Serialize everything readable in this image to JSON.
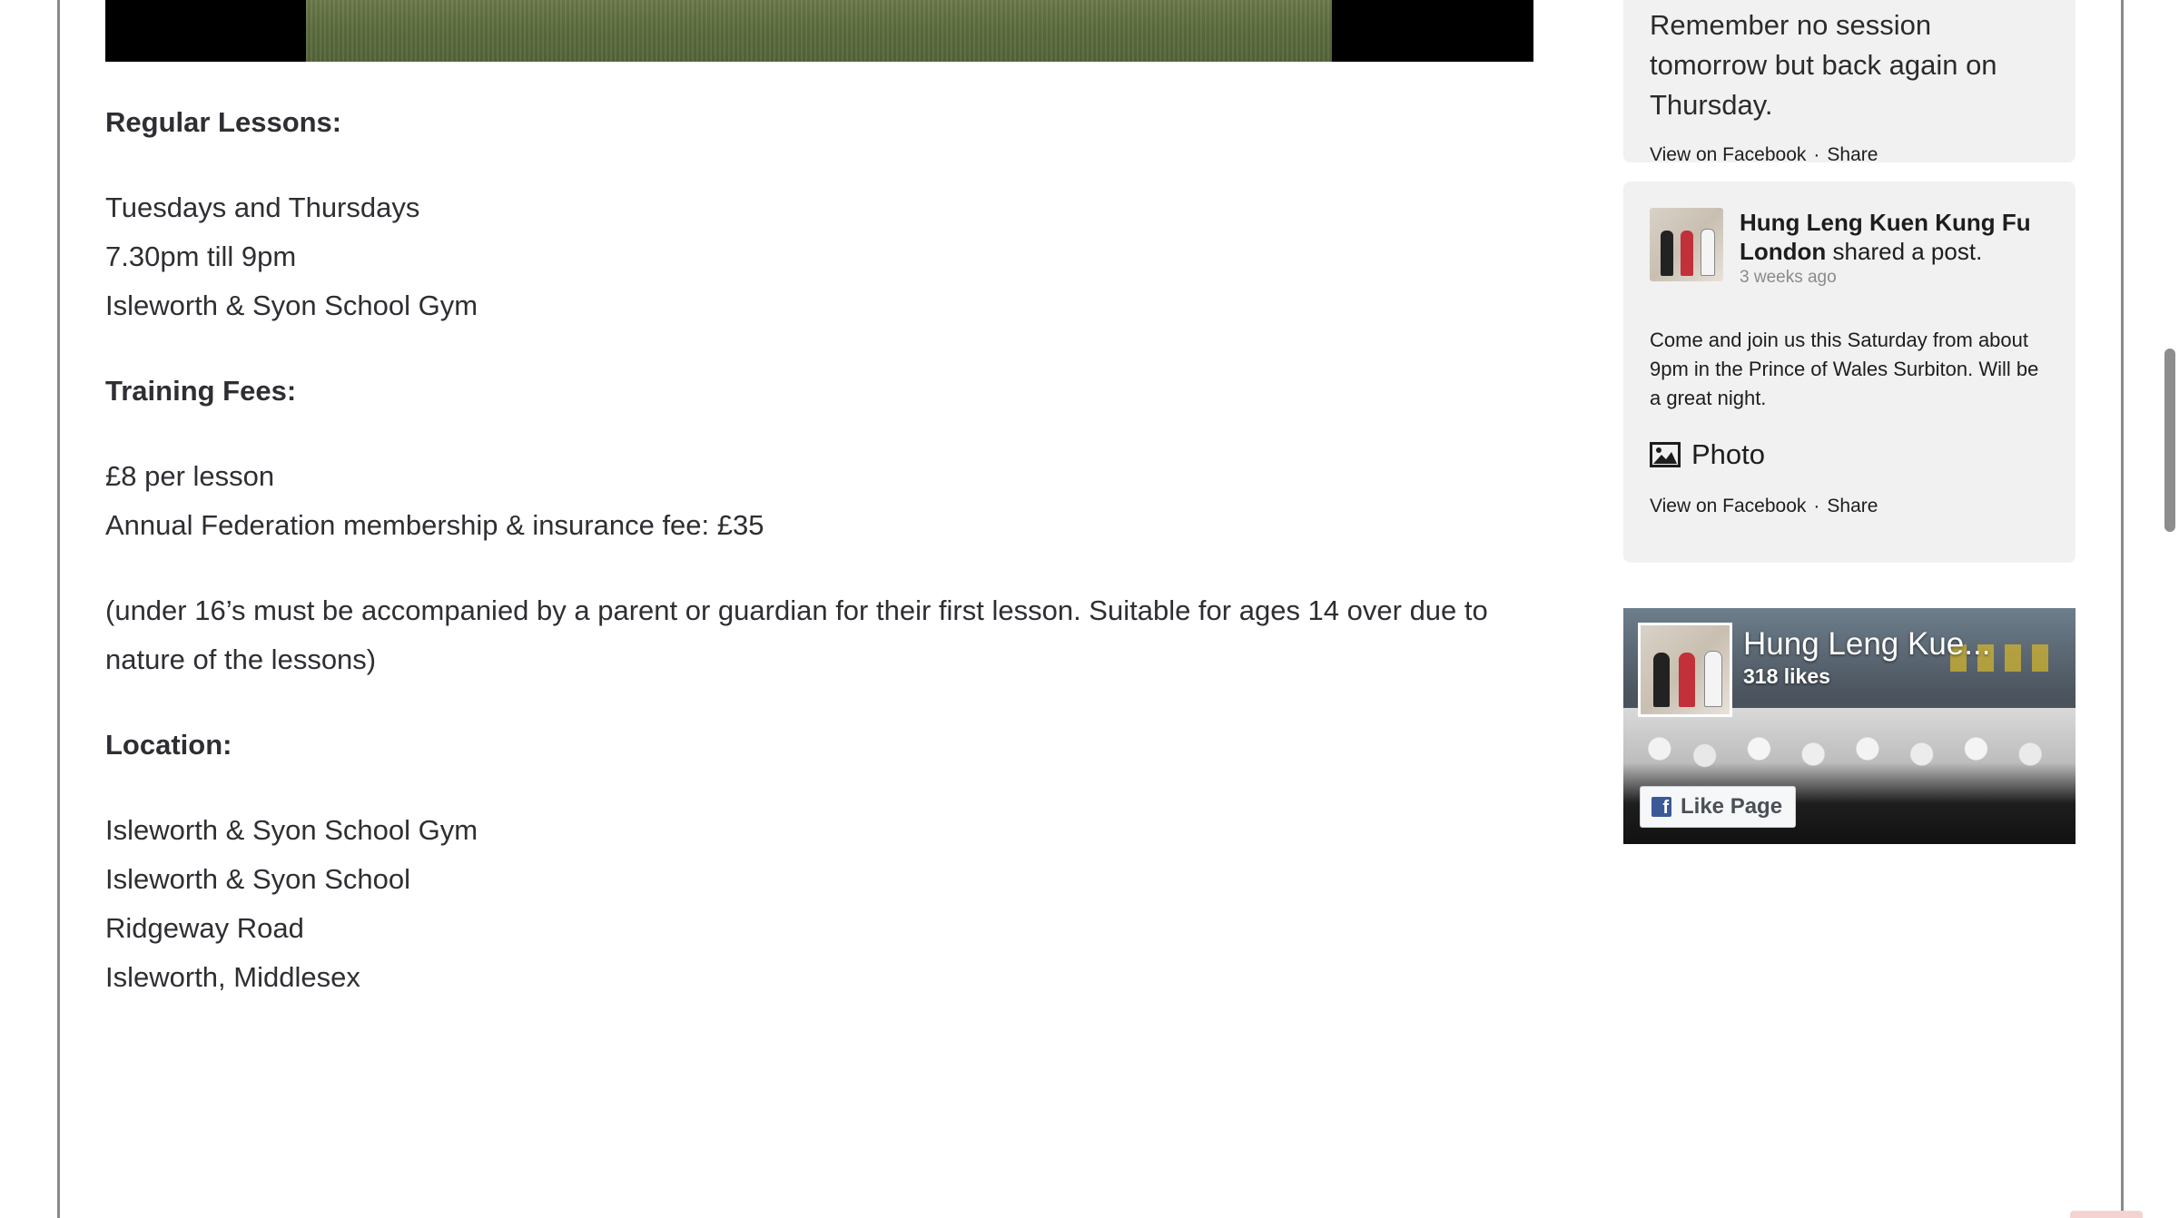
{
  "main": {
    "regular_heading": "Regular Lessons:",
    "regular_lines": [
      "Tuesdays and Thursdays",
      "7.30pm till 9pm",
      "Isleworth & Syon School Gym"
    ],
    "fees_heading": "Training Fees:",
    "fees_lines": [
      "£8 per lesson",
      "Annual Federation membership & insurance fee: £35"
    ],
    "note": "(under 16’s must be accompanied by a parent or guardian for their first lesson. Suitable for ages 14 over due to nature of the lessons)",
    "location_heading": "Location:",
    "location_lines": [
      "Isleworth & Syon School Gym",
      "Isleworth & Syon School",
      "Ridgeway Road",
      "Isleworth, Middlesex"
    ]
  },
  "sidebar": {
    "post1": {
      "text": "Remember no session tomorrow but back again on Thursday.",
      "view_link": "View on Facebook",
      "separator": "·",
      "share_link": "Share"
    },
    "post2": {
      "author": "Hung Leng Kuen Kung Fu London",
      "action": "shared a post.",
      "time": "3 weeks ago",
      "body": "Come and join us this Saturday from about 9pm in the Prince of Wales Surbiton. Will be a great night.",
      "photo_label": "Photo",
      "photo_icon": "photo-icon",
      "view_link": "View on Facebook",
      "separator": "·",
      "share_link": "Share"
    },
    "page_plugin": {
      "title": "Hung Leng Kue...",
      "likes": "318 likes",
      "like_button": "Like Page",
      "like_icon": "facebook-icon"
    }
  },
  "colors": {
    "card_bg": "#f1f1f1",
    "text": "#2e2e33",
    "muted": "#8a8a8a",
    "facebook_blue": "#3b5998"
  }
}
